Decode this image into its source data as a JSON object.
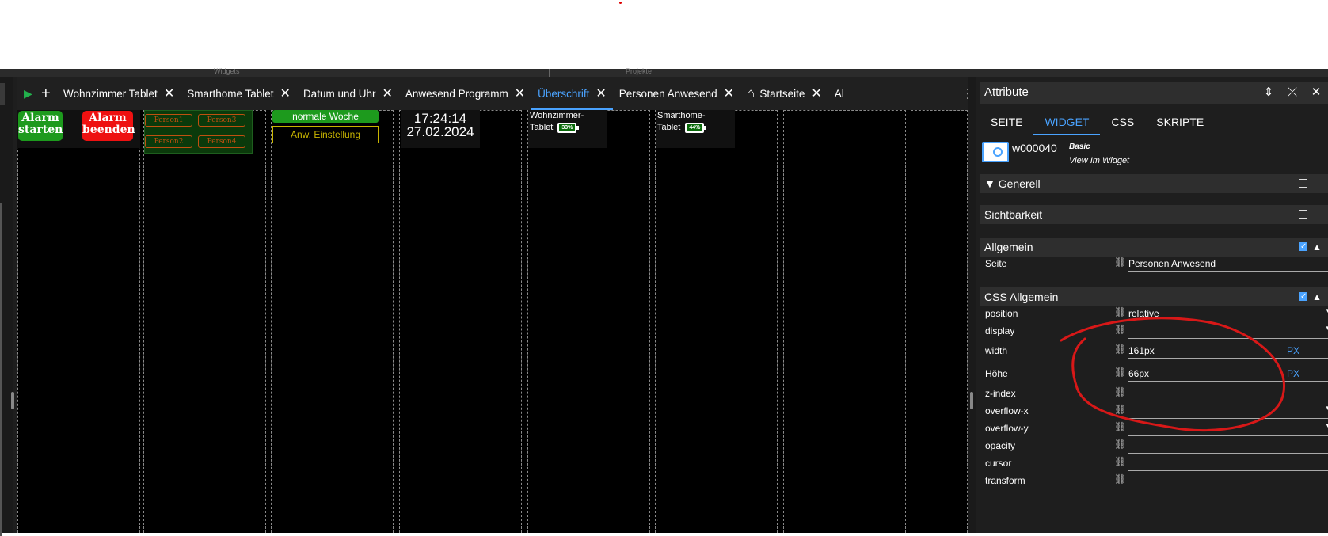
{
  "topbar": {
    "left_label": "Widgets",
    "right_label": "Projekte"
  },
  "toolbar": {
    "play_icon": "play-icon",
    "add_icon": "plus-icon"
  },
  "tabs": [
    {
      "label": "Wohnzimmer Tablet"
    },
    {
      "label": "Smarthome Tablet"
    },
    {
      "label": "Datum und Uhr"
    },
    {
      "label": "Anwesend Programm"
    },
    {
      "label": "Überschrift",
      "active": true
    },
    {
      "label": "Personen Anwesend"
    },
    {
      "label": "Startseite",
      "icon": "home-icon"
    },
    {
      "label": "Al"
    }
  ],
  "widgets": {
    "alarm_start": "Alarm starten",
    "alarm_end": "Alarm beenden",
    "persons": [
      "Person1",
      "Person3",
      "Person2",
      "Person4"
    ],
    "woche": "normale Woche",
    "anw": "Anw. Einstellung",
    "time": "17:24:14",
    "date": "27.02.2024",
    "tablet1": {
      "name_line1": "Wohnzimmer-",
      "name_line2": "Tablet",
      "battery": "33%"
    },
    "tablet2": {
      "name_line1": "Smarthome-",
      "name_line2": "Tablet",
      "battery": "44%"
    }
  },
  "panel": {
    "title": "Attribute",
    "tabs": [
      "SEITE",
      "WIDGET",
      "CSS",
      "SKRIPTE"
    ],
    "active_tab": "WIDGET",
    "widget_id": "w000040",
    "widget_set": "Basic",
    "widget_name": "View Im Widget",
    "sections": {
      "generell": "Generell",
      "sichtbarkeit": "Sichtbarkeit",
      "allgemein": "Allgemein",
      "css_allgemein": "CSS Allgemein"
    },
    "allgemein_rows": [
      {
        "label": "Seite",
        "value": "Personen Anwesend"
      }
    ],
    "css_rows": [
      {
        "label": "position",
        "value": "relative",
        "dropdown": true
      },
      {
        "label": "display",
        "value": "",
        "dropdown": true
      },
      {
        "label": "width",
        "value": "161px",
        "unit": "PX"
      },
      {
        "label": "Höhe",
        "value": "66px",
        "unit": "PX"
      },
      {
        "label": "z-index",
        "value": ""
      },
      {
        "label": "overflow-x",
        "value": "",
        "dropdown": true
      },
      {
        "label": "overflow-y",
        "value": "",
        "dropdown": true
      },
      {
        "label": "opacity",
        "value": ""
      },
      {
        "label": "cursor",
        "value": ""
      },
      {
        "label": "transform",
        "value": ""
      }
    ]
  },
  "colors": {
    "accent": "#4aa3ff",
    "alarm_start": "#1d9a1d",
    "alarm_end": "#ee1111",
    "annotation": "#d81818"
  }
}
